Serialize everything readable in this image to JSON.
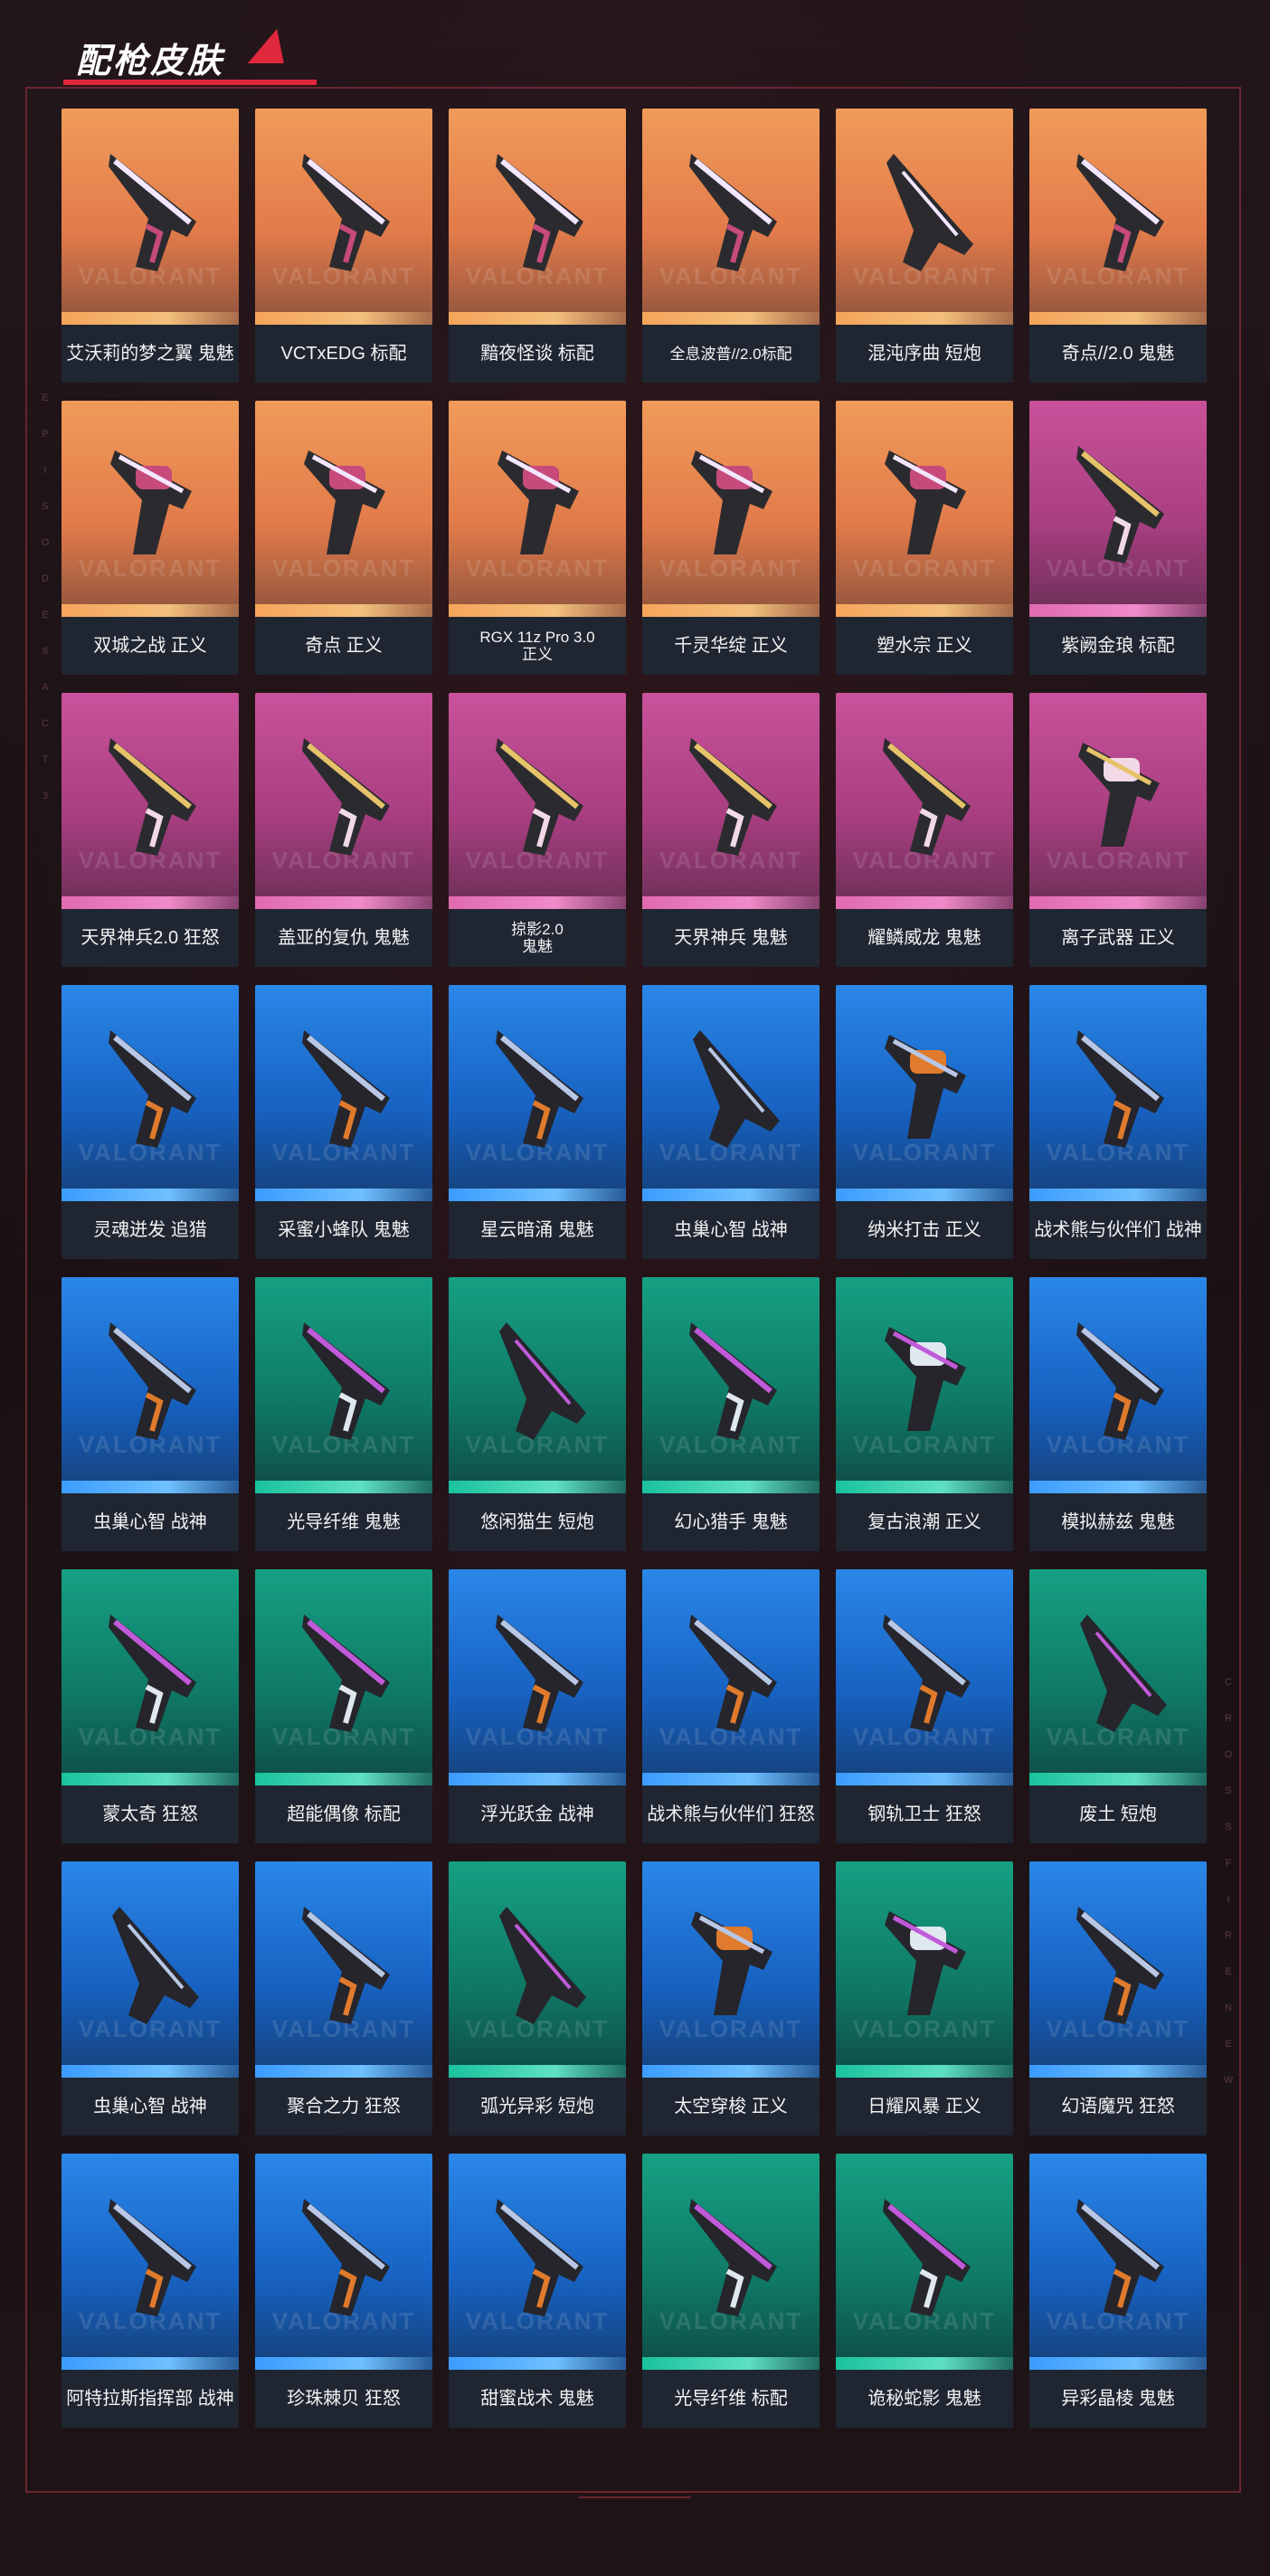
{
  "header": {
    "title": "配枪皮肤"
  },
  "side_letters_left": [
    "E",
    "P",
    "I",
    "S",
    "O",
    "D",
    "E",
    "8",
    "A",
    "C",
    "T",
    "3"
  ],
  "side_letters_right": [
    "C",
    "R",
    "O",
    "S",
    "S",
    "F",
    "I",
    "R",
    "E",
    "N",
    "E",
    "W"
  ],
  "watermark": "VALORANT",
  "colors": {
    "orange": "#e27b4a",
    "pink": "#a83e80",
    "blue": "#1762c2",
    "green": "#0f7a66",
    "accent": "#e0283c"
  },
  "skins": [
    {
      "label": "艾沃莉的梦之翼 鬼魅",
      "tier": "orange",
      "icon": "pistol-icon"
    },
    {
      "label": "VCTxEDG 标配",
      "tier": "orange",
      "icon": "pistol-icon"
    },
    {
      "label": "黯夜怪谈 标配",
      "tier": "orange",
      "icon": "pistol-icon"
    },
    {
      "label": "全息波普//2.0标配",
      "tier": "orange",
      "icon": "pistol-icon"
    },
    {
      "label": "混沌序曲 短炮",
      "tier": "orange",
      "icon": "shotgun-icon"
    },
    {
      "label": "奇点//2.0 鬼魅",
      "tier": "orange",
      "icon": "pistol-icon"
    },
    {
      "label": "双城之战 正义",
      "tier": "orange",
      "icon": "revolver-icon"
    },
    {
      "label": "奇点 正义",
      "tier": "orange",
      "icon": "revolver-icon"
    },
    {
      "label": "RGX 11z Pro 3.0\n正义",
      "tier": "orange",
      "icon": "revolver-icon"
    },
    {
      "label": "千灵华绽 正义",
      "tier": "orange",
      "icon": "revolver-icon"
    },
    {
      "label": "塑水宗 正义",
      "tier": "orange",
      "icon": "revolver-icon"
    },
    {
      "label": "紫阙金琅 标配",
      "tier": "pink",
      "icon": "pistol-icon"
    },
    {
      "label": "天界神兵2.0 狂怒",
      "tier": "pink",
      "icon": "pistol-icon"
    },
    {
      "label": "盖亚的复仇 鬼魅",
      "tier": "pink",
      "icon": "pistol-icon"
    },
    {
      "label": "掠影2.0\n鬼魅",
      "tier": "pink",
      "icon": "pistol-icon"
    },
    {
      "label": "天界神兵 鬼魅",
      "tier": "pink",
      "icon": "pistol-icon"
    },
    {
      "label": "耀鳞威龙 鬼魅",
      "tier": "pink",
      "icon": "pistol-icon"
    },
    {
      "label": "离子武器 正义",
      "tier": "pink",
      "icon": "revolver-icon"
    },
    {
      "label": "灵魂迸发 追猎",
      "tier": "blue",
      "icon": "pistol-icon"
    },
    {
      "label": "采蜜小蜂队 鬼魅",
      "tier": "blue",
      "icon": "pistol-icon"
    },
    {
      "label": "星云暗涌 鬼魅",
      "tier": "blue",
      "icon": "pistol-icon"
    },
    {
      "label": "虫巢心智 战神",
      "tier": "blue",
      "icon": "shotgun-icon"
    },
    {
      "label": "纳米打击 正义",
      "tier": "blue",
      "icon": "revolver-icon"
    },
    {
      "label": "战术熊与伙伴们 战神",
      "tier": "blue",
      "icon": "pistol-icon"
    },
    {
      "label": "虫巢心智 战神",
      "tier": "blue",
      "icon": "pistol-icon"
    },
    {
      "label": "光导纤维 鬼魅",
      "tier": "green",
      "icon": "pistol-icon"
    },
    {
      "label": "悠闲猫生 短炮",
      "tier": "green",
      "icon": "shotgun-icon"
    },
    {
      "label": "幻心猎手 鬼魅",
      "tier": "green",
      "icon": "pistol-icon"
    },
    {
      "label": "复古浪潮 正义",
      "tier": "green",
      "icon": "revolver-icon"
    },
    {
      "label": "模拟赫兹 鬼魅",
      "tier": "blue",
      "icon": "pistol-icon"
    },
    {
      "label": "蒙太奇 狂怒",
      "tier": "green",
      "icon": "pistol-icon"
    },
    {
      "label": "超能偶像 标配",
      "tier": "green",
      "icon": "pistol-icon"
    },
    {
      "label": "浮光跃金 战神",
      "tier": "blue",
      "icon": "pistol-icon"
    },
    {
      "label": "战术熊与伙伴们 狂怒",
      "tier": "blue",
      "icon": "pistol-icon"
    },
    {
      "label": "钢轨卫士 狂怒",
      "tier": "blue",
      "icon": "pistol-icon"
    },
    {
      "label": "废土 短炮",
      "tier": "green",
      "icon": "shotgun-icon"
    },
    {
      "label": "虫巢心智 战神",
      "tier": "blue",
      "icon": "shotgun-icon"
    },
    {
      "label": "聚合之力 狂怒",
      "tier": "blue",
      "icon": "pistol-icon"
    },
    {
      "label": "弧光异彩 短炮",
      "tier": "green",
      "icon": "shotgun-icon"
    },
    {
      "label": "太空穿梭 正义",
      "tier": "blue",
      "icon": "revolver-icon"
    },
    {
      "label": "日耀风暴 正义",
      "tier": "green",
      "icon": "revolver-icon"
    },
    {
      "label": "幻语魔咒 狂怒",
      "tier": "blue",
      "icon": "pistol-icon"
    },
    {
      "label": "阿特拉斯指挥部 战神",
      "tier": "blue",
      "icon": "pistol-icon"
    },
    {
      "label": "珍珠棘贝 狂怒",
      "tier": "blue",
      "icon": "pistol-icon"
    },
    {
      "label": "甜蜜战术 鬼魅",
      "tier": "blue",
      "icon": "pistol-icon"
    },
    {
      "label": "光导纤维 标配",
      "tier": "green",
      "icon": "pistol-icon"
    },
    {
      "label": "诡秘蛇影 鬼魅",
      "tier": "green",
      "icon": "pistol-icon"
    },
    {
      "label": "异彩晶棱 鬼魅",
      "tier": "blue",
      "icon": "pistol-icon"
    }
  ]
}
